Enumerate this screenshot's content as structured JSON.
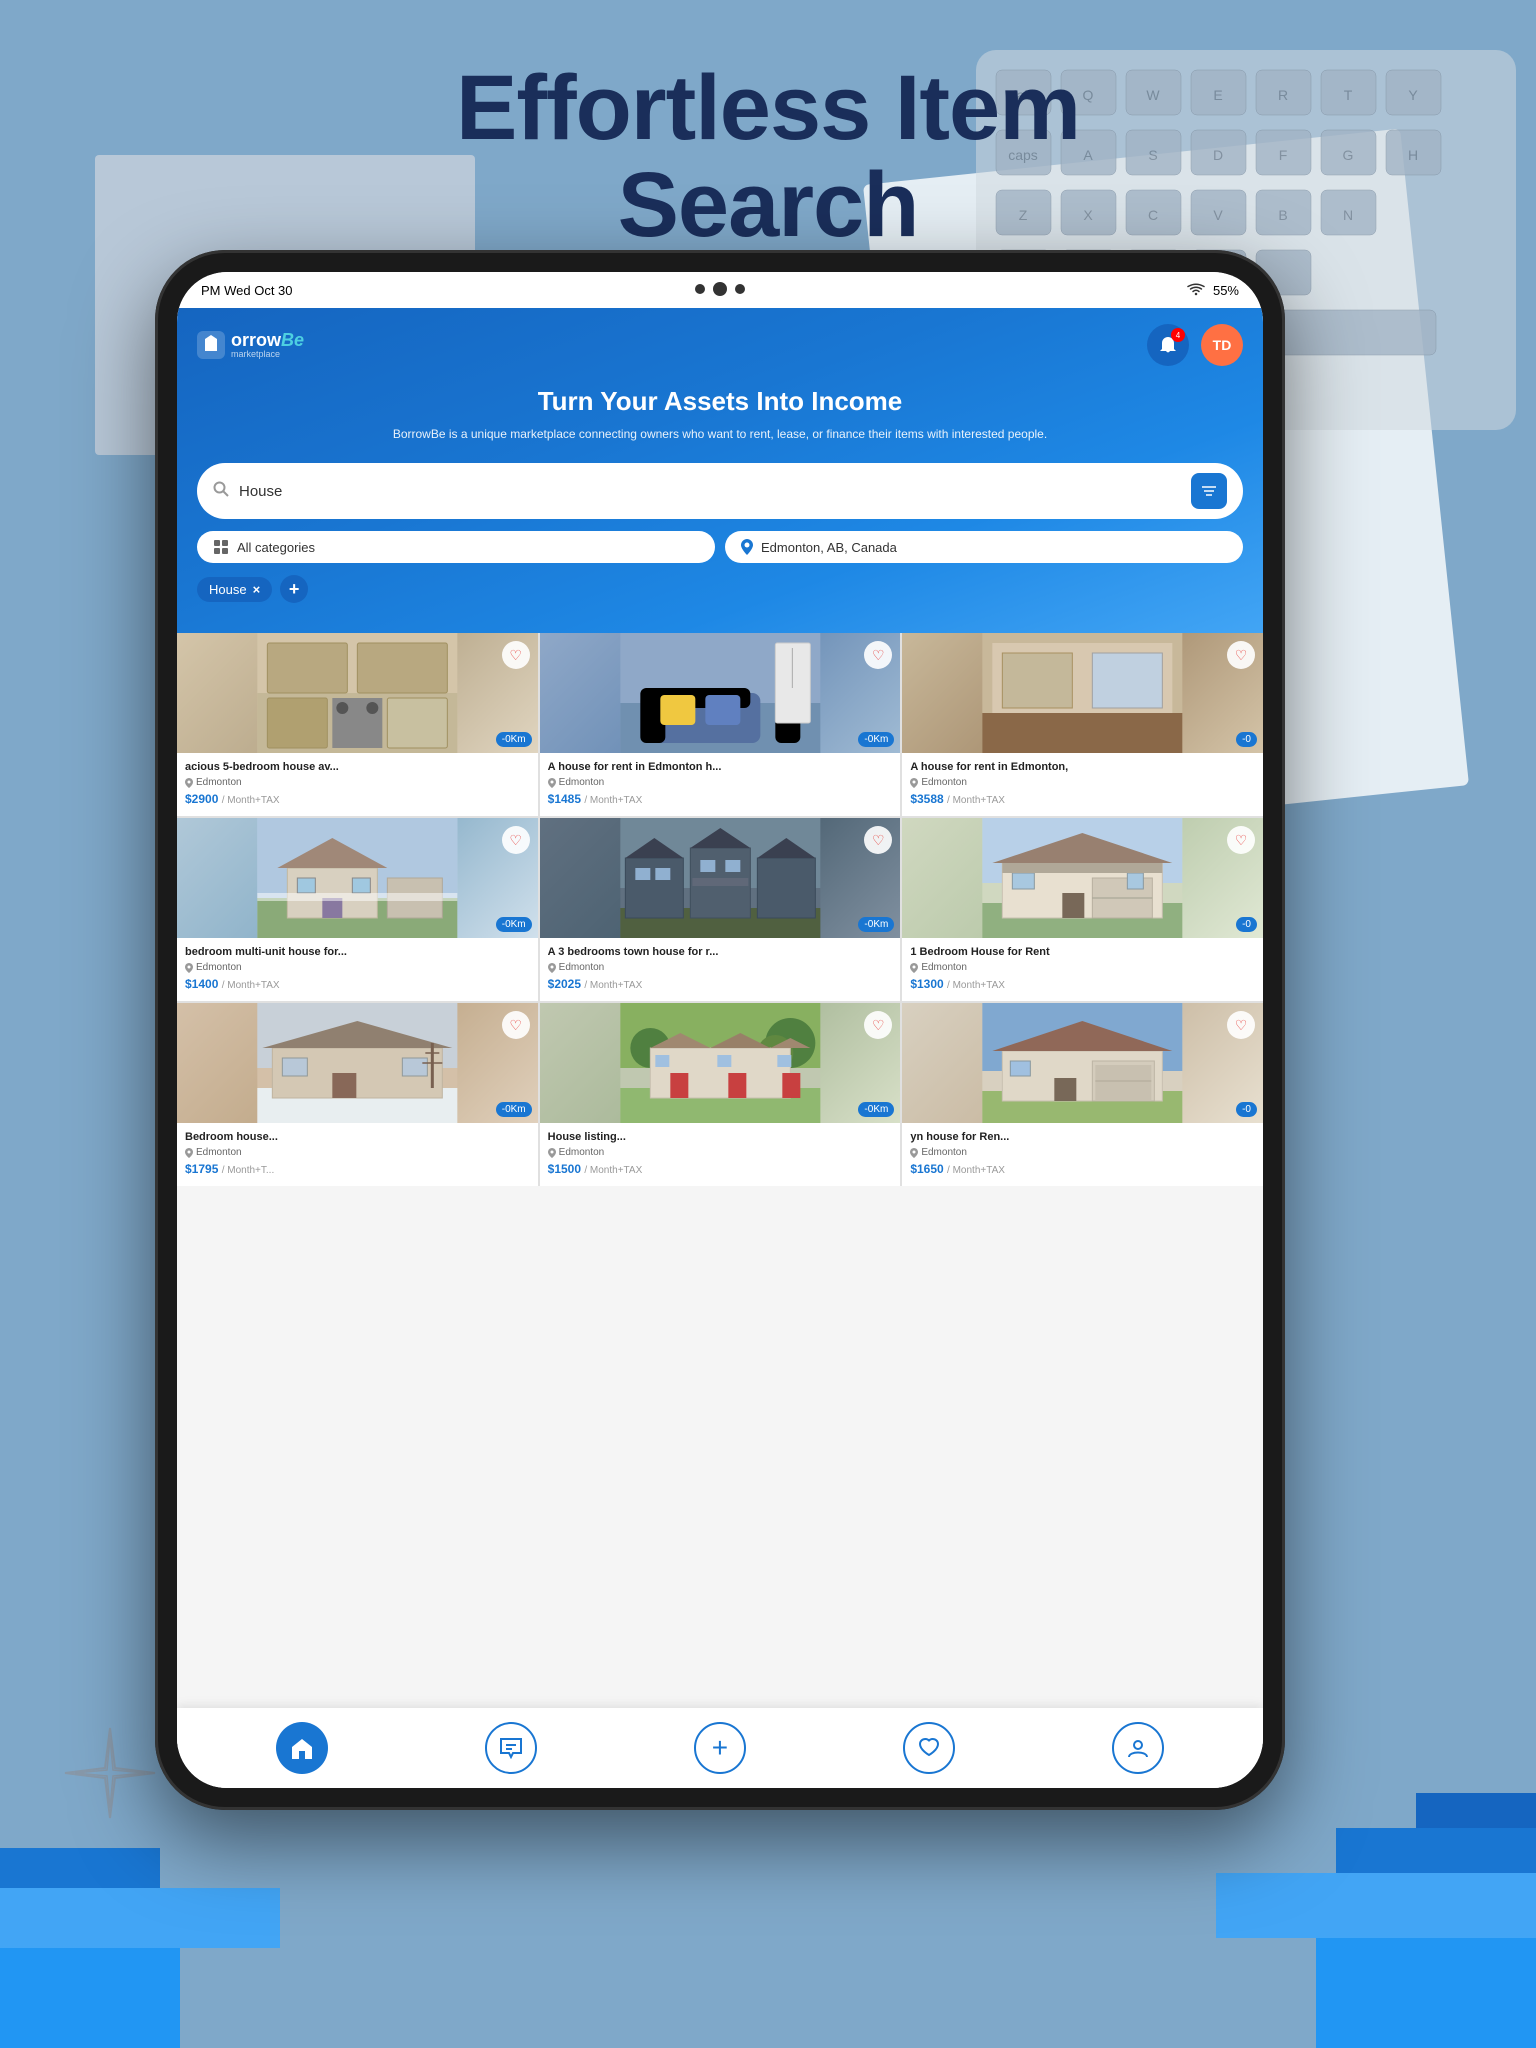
{
  "page": {
    "title_line1": "Effortless Item",
    "title_line2": "Search"
  },
  "status_bar": {
    "time": "PM  Wed Oct 30",
    "wifi": "WiFi",
    "battery": "55%"
  },
  "header": {
    "logo": "borrowBe",
    "logo_sub": "marketplace",
    "hero_title": "Turn Your Assets Into Income",
    "hero_subtitle": "BorrowBe is a unique marketplace connecting owners who want to rent, lease, or finance their items with interested people.",
    "search_value": "House",
    "search_placeholder": "House",
    "filter_icon": "≡",
    "category_label": "All categories",
    "location_label": "Edmonton, AB, Canada",
    "tag_label": "House",
    "tag_close": "×",
    "tag_add": "+"
  },
  "nav": {
    "home_icon": "⌂",
    "messages_icon": "💬",
    "add_icon": "+",
    "favorites_icon": "♡",
    "profile_icon": "👤"
  },
  "listings": [
    {
      "title": "acious 5-bedroom house av...",
      "location": "Edmonton",
      "price": "$2900",
      "period": "/ Month+TAX",
      "distance": "-0Km",
      "img_class": "img-kitchen"
    },
    {
      "title": "A house for rent in Edmonton h...",
      "location": "Edmonton",
      "price": "$1485",
      "period": "/ Month+TAX",
      "distance": "-0Km",
      "img_class": "img-living"
    },
    {
      "title": "A house for rent in Edmonton,",
      "location": "Edmonton",
      "price": "$3588",
      "period": "/ Month+TAX",
      "distance": "-0",
      "img_class": "img-room"
    },
    {
      "title": "bedroom multi-unit house for...",
      "location": "Edmonton",
      "price": "$1400",
      "period": "/ Month+TAX",
      "distance": "-0Km",
      "img_class": "img-house1"
    },
    {
      "title": "A 3 bedrooms town house for r...",
      "location": "Edmonton",
      "price": "$2025",
      "period": "/ Month+TAX",
      "distance": "-0Km",
      "img_class": "img-townhouse"
    },
    {
      "title": "1 Bedroom House for Rent",
      "location": "Edmonton",
      "price": "$1300",
      "period": "/ Month+TAX",
      "distance": "-0",
      "img_class": "img-house2"
    },
    {
      "title": "Bedroom house...",
      "location": "Edmonton",
      "price": "$1795",
      "period": "/ Month+T...",
      "distance": "-0Km",
      "img_class": "img-house3"
    },
    {
      "title": "House listing...",
      "location": "Edmonton",
      "price": "$1500",
      "period": "/ Month+TAX",
      "distance": "-0Km",
      "img_class": "img-house4"
    },
    {
      "title": "yn house for Ren...",
      "location": "Edmonton",
      "price": "$1650",
      "period": "/ Month+TAX",
      "distance": "-0",
      "img_class": "img-house5"
    }
  ]
}
